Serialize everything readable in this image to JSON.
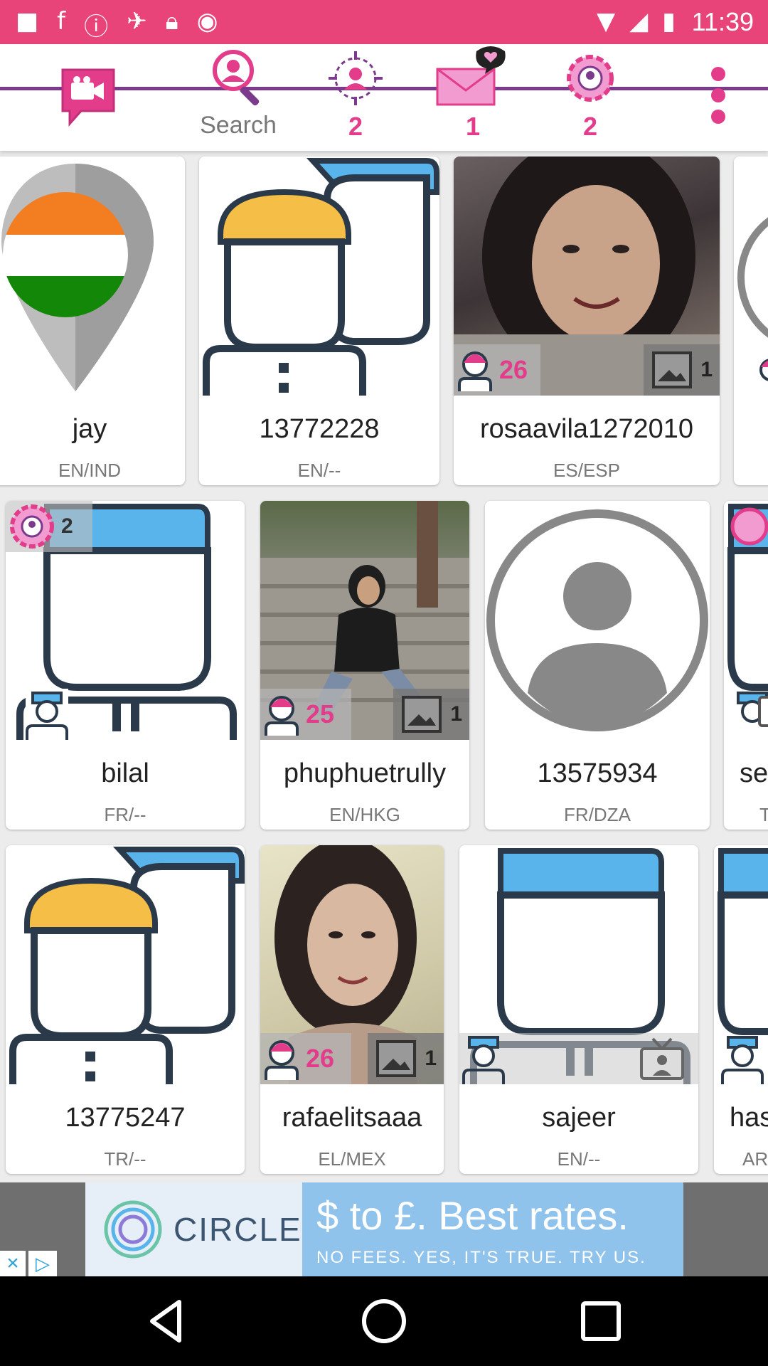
{
  "status": {
    "time": "11:39"
  },
  "tabs": [
    {
      "id": "video-chat",
      "label": ""
    },
    {
      "id": "search",
      "label": "Search"
    },
    {
      "id": "visitors",
      "label": "2"
    },
    {
      "id": "messages",
      "label": "1"
    },
    {
      "id": "friends",
      "label": "2"
    }
  ],
  "cards": [
    {
      "name": "jay",
      "lang": "EN/IND"
    },
    {
      "name": "13772228",
      "lang": "EN/--"
    },
    {
      "name": "rosaavila1272010",
      "lang": "ES/ESP",
      "age": "26",
      "photos": "1"
    },
    {
      "name": "bilal",
      "lang": "FR/--",
      "friends": "2"
    },
    {
      "name": "phuphuetrully",
      "lang": "EN/HKG",
      "age": "25",
      "photos": "1"
    },
    {
      "name": "13575934",
      "lang": "FR/DZA"
    },
    {
      "name": "se",
      "lang": "T"
    },
    {
      "name": "13775247",
      "lang": "TR/--"
    },
    {
      "name": "rafaelitsaaa",
      "lang": "EL/MEX",
      "age": "26",
      "photos": "1"
    },
    {
      "name": "sajeer",
      "lang": "EN/--"
    },
    {
      "name": "has",
      "lang": "AR"
    }
  ],
  "ad": {
    "brand": "CIRCLE",
    "headline": "$ to £. Best rates.",
    "subline": "NO FEES. YES, IT'S TRUE. TRY US."
  },
  "colors": {
    "status_bar": "#e8447a",
    "accent": "#e23c8a",
    "tab_line": "#7b3a8c"
  }
}
